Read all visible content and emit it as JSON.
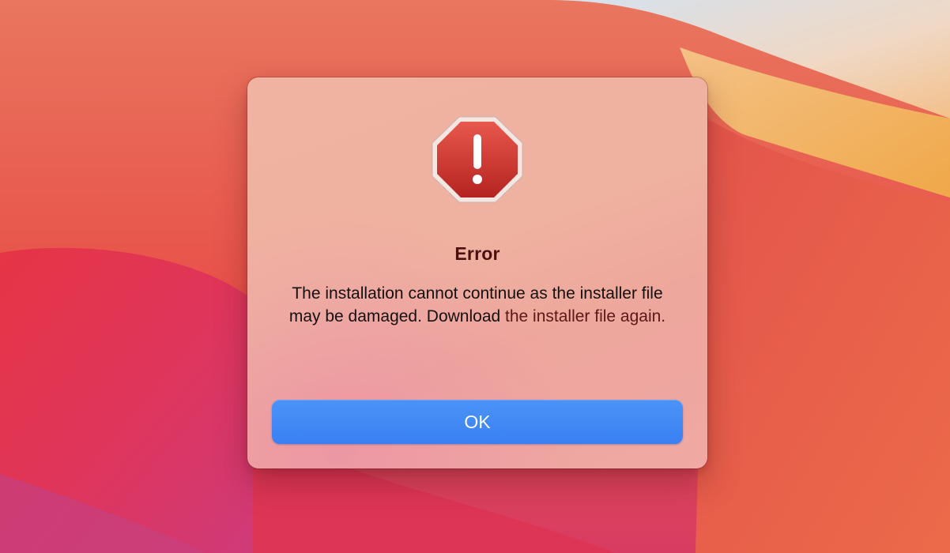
{
  "dialog": {
    "icon": "stop-sign-exclamation-icon",
    "title": "Error",
    "message_part1": "The installation cannot continue as the installer file may be damaged. Download ",
    "message_part2": "the installer file again.",
    "ok_label": "OK"
  },
  "colors": {
    "button_blue": "#3a80f3",
    "icon_red": "#c8322c",
    "title_color": "#4a1010"
  }
}
